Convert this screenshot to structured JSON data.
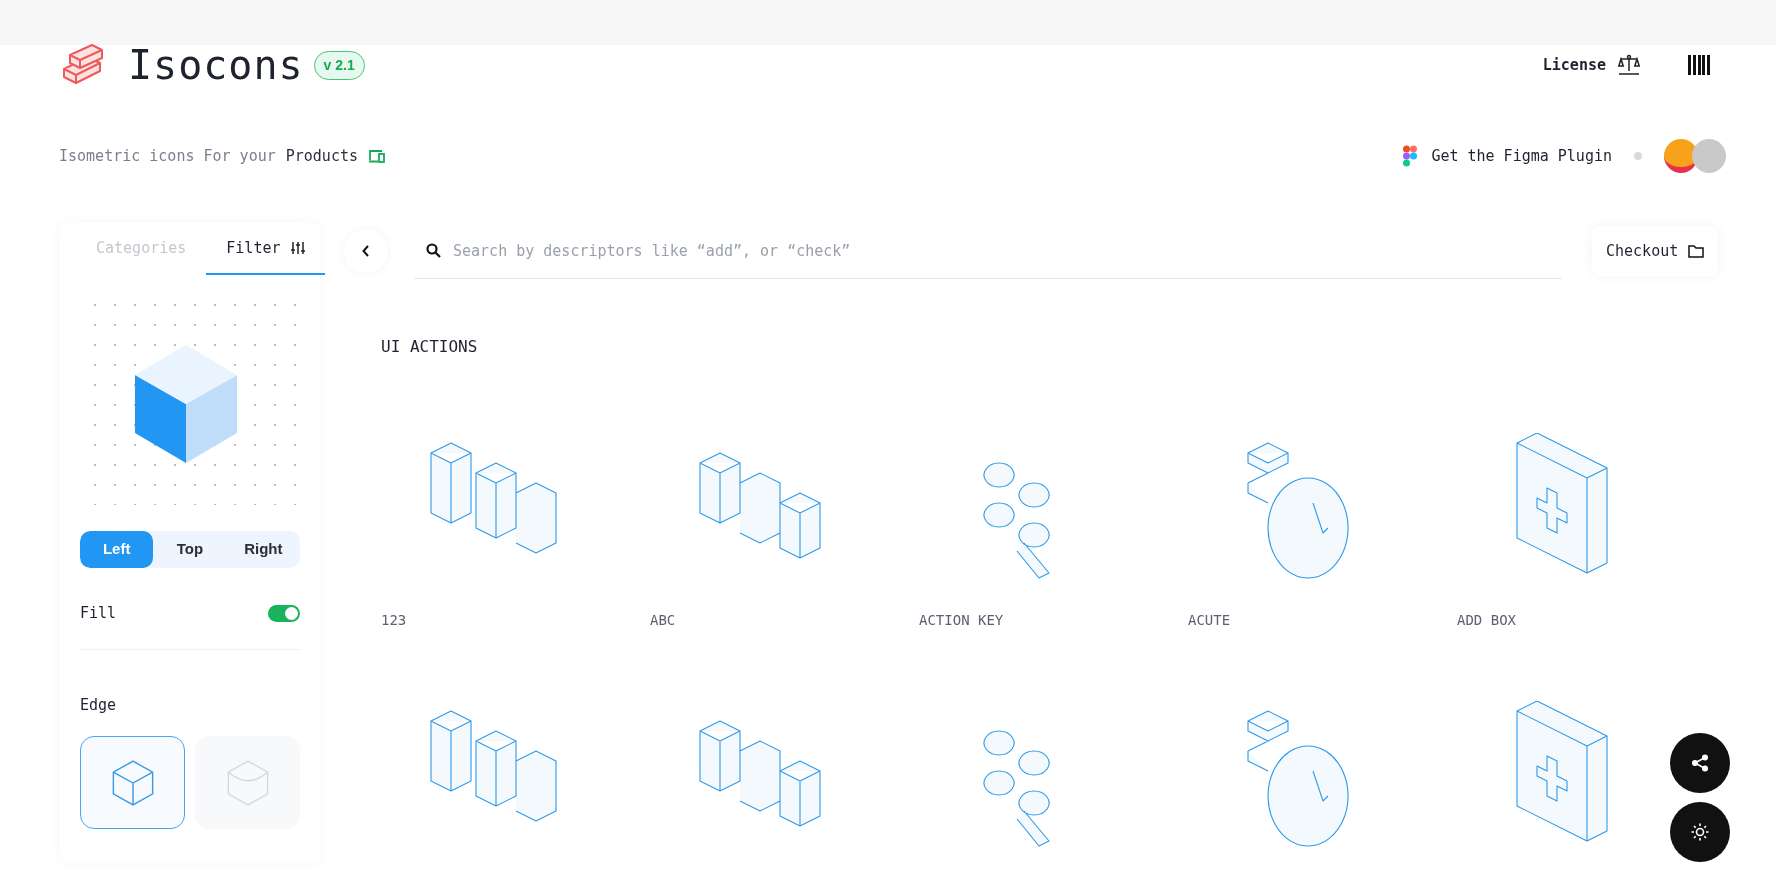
{
  "brand": {
    "name": "Isocons",
    "version": "v 2.1"
  },
  "nav": {
    "license": "License"
  },
  "tagline": {
    "text": "Isometric icons For your",
    "highlight": "Products"
  },
  "plugin": {
    "label": "Get the Figma Plugin"
  },
  "sidebar": {
    "tabs": [
      {
        "label": "Categories",
        "selected": false
      },
      {
        "label": "Filter",
        "selected": true
      }
    ],
    "sides": [
      {
        "label": "Left",
        "selected": true
      },
      {
        "label": "Top",
        "selected": false
      },
      {
        "label": "Right",
        "selected": false
      }
    ],
    "fill": {
      "label": "Fill",
      "on": true
    },
    "edge": {
      "label": "Edge",
      "options": [
        {
          "selected": true
        },
        {
          "selected": false
        }
      ]
    }
  },
  "search": {
    "placeholder": "Search by descriptors like “add”, or “check”"
  },
  "checkout": "Checkout",
  "section": {
    "title": "UI ACTIONS",
    "items": [
      {
        "label": "123"
      },
      {
        "label": "ABC"
      },
      {
        "label": "ACTION KEY"
      },
      {
        "label": "ACUTE"
      },
      {
        "label": "ADD BOX"
      }
    ]
  }
}
